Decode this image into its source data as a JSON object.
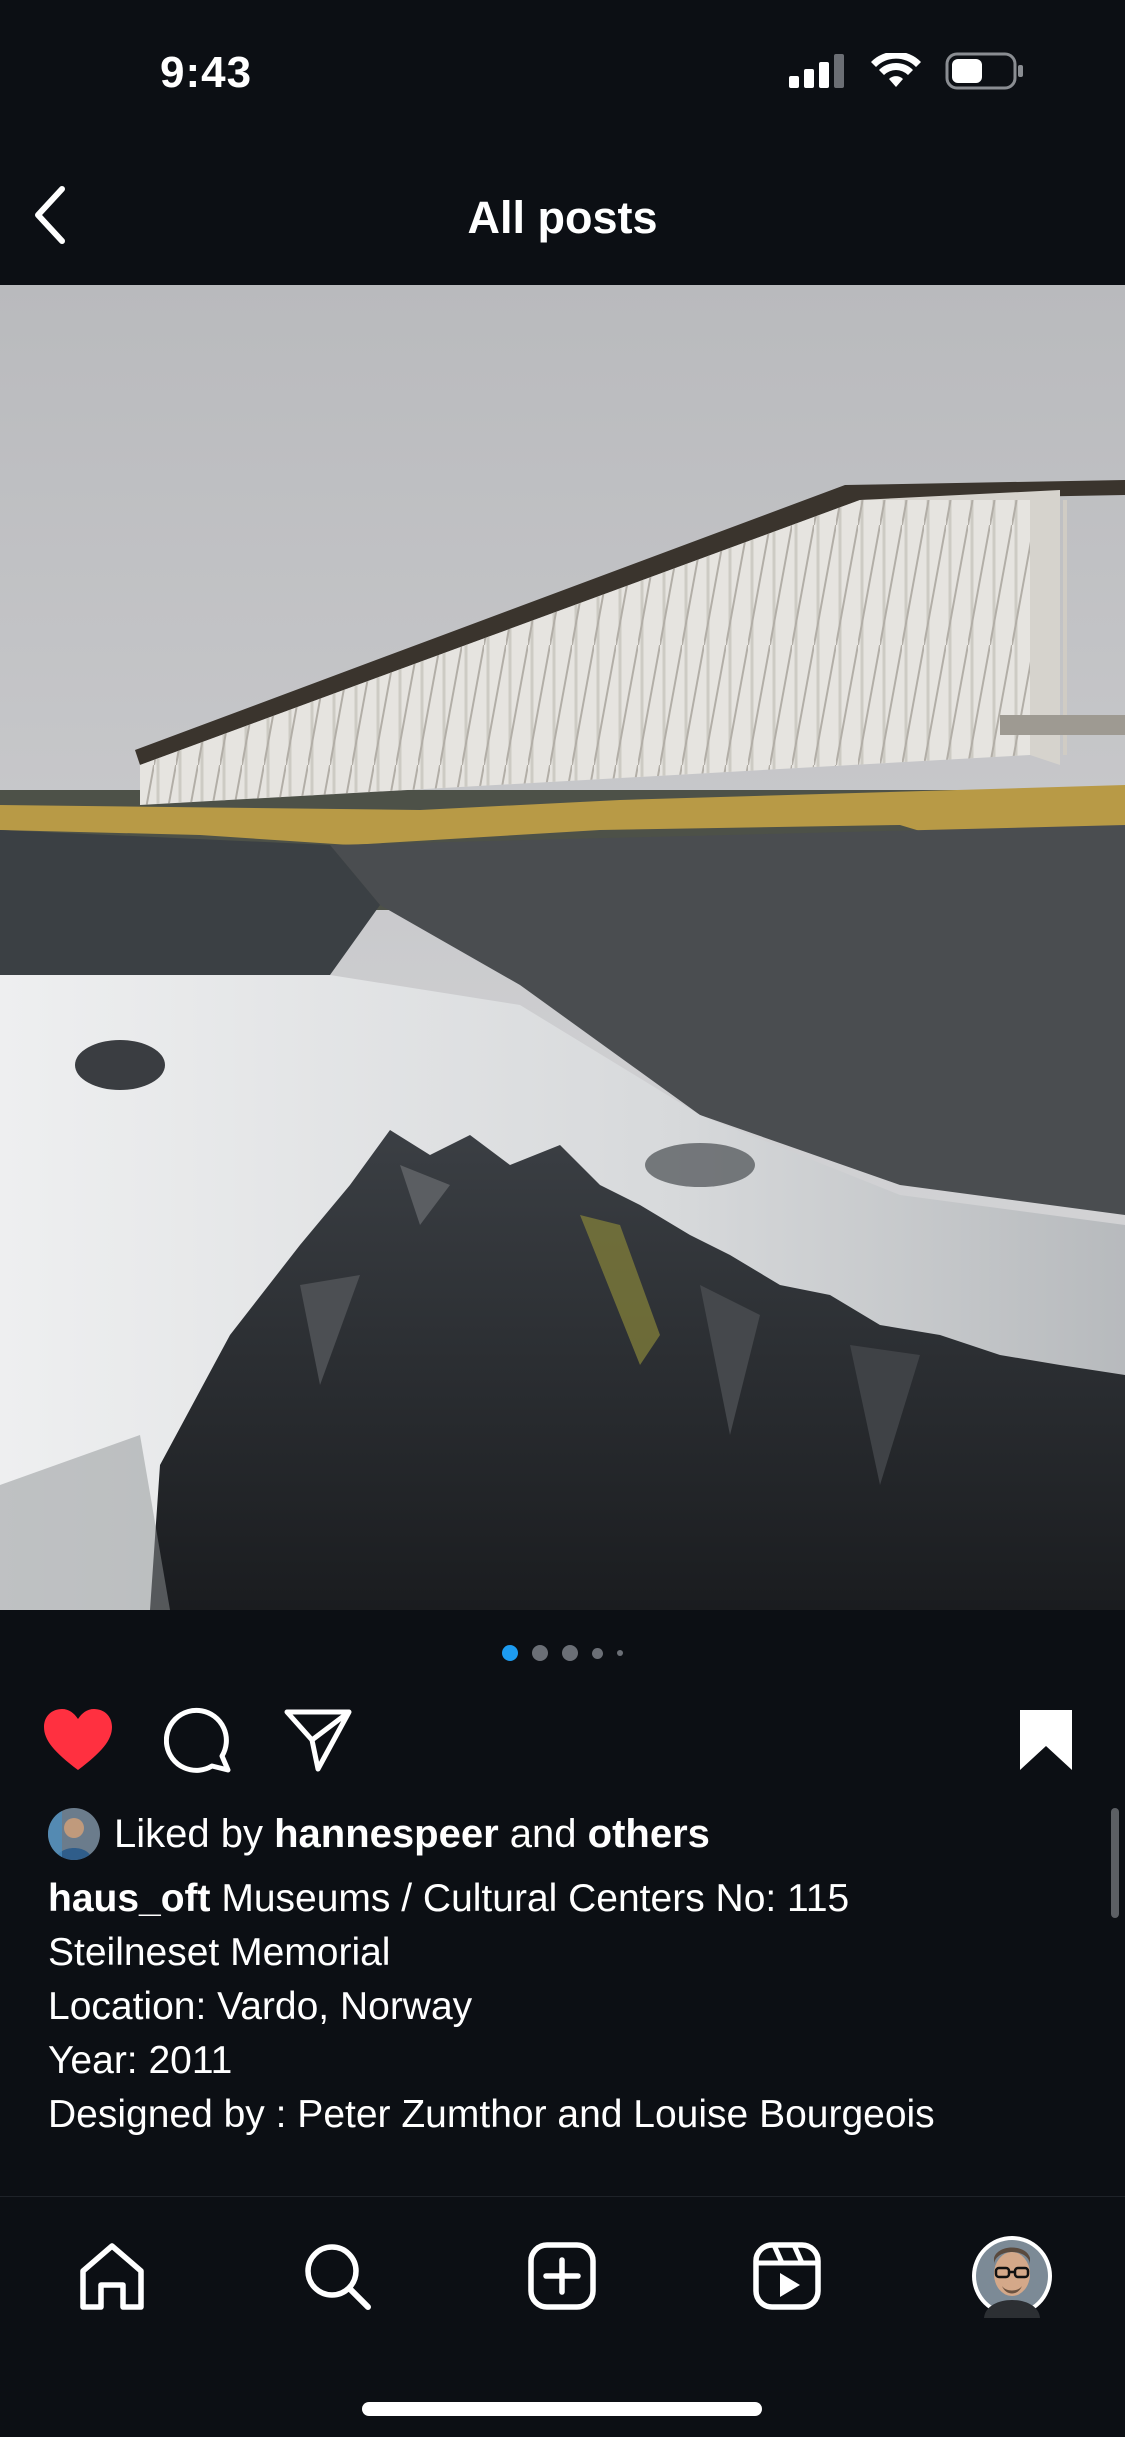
{
  "status_bar": {
    "time": "9:43"
  },
  "header": {
    "title": "All posts"
  },
  "carousel": {
    "total": 5,
    "current": 1,
    "active_color": "#1d9bf0"
  },
  "actions": {
    "liked": true,
    "saved": true,
    "like_color": "#ff3040"
  },
  "likes": {
    "prefix": "Liked by",
    "user": "hannespeer",
    "conj": "and",
    "others": "others"
  },
  "post": {
    "username": "haus_oft",
    "caption_lines": [
      "Museums / Cultural Centers No: 115",
      "Steilneset Memorial",
      "Location: Vardo, Norway",
      "Year: 2011",
      "Designed by : Peter Zumthor and Louise Bourgeois"
    ]
  },
  "tabs": [
    "home-icon",
    "search-icon",
    "create-icon",
    "reels-icon",
    "profile-avatar"
  ]
}
